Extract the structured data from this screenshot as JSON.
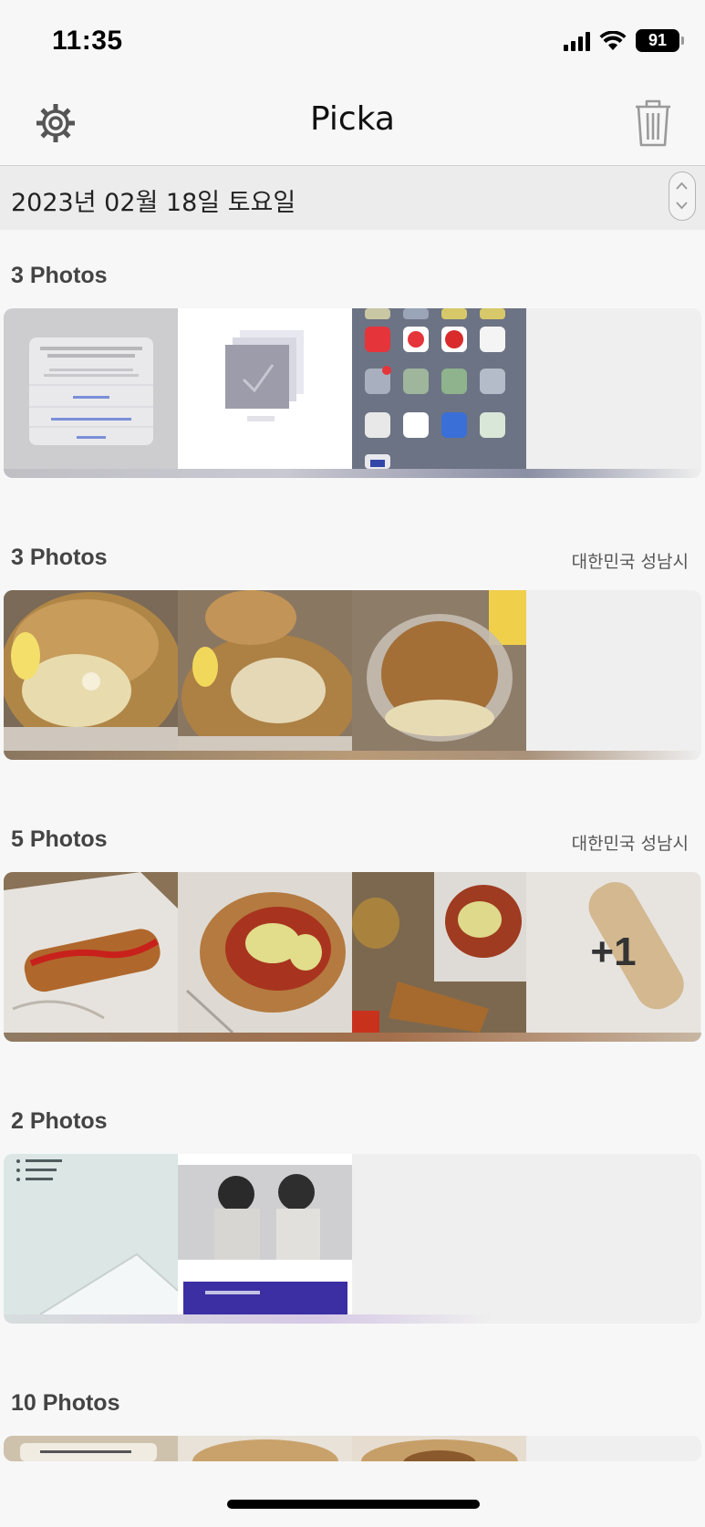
{
  "status_bar": {
    "time": "11:35",
    "battery": "91"
  },
  "nav": {
    "title": "Picka",
    "settings_icon": "gear-icon",
    "trash_icon": "trash-icon"
  },
  "date_header": {
    "date": "2023년 02월 18일 토요일",
    "stepper_icon": "chevron-up-down-icon"
  },
  "groups": [
    {
      "count": "3 Photos",
      "location": ""
    },
    {
      "count": "3 Photos",
      "location": "대한민국 성남시"
    },
    {
      "count": "5 Photos",
      "location": "대한민국 성남시",
      "more": "+1"
    },
    {
      "count": "2 Photos",
      "location": ""
    },
    {
      "count": "10 Photos",
      "location": ""
    }
  ]
}
